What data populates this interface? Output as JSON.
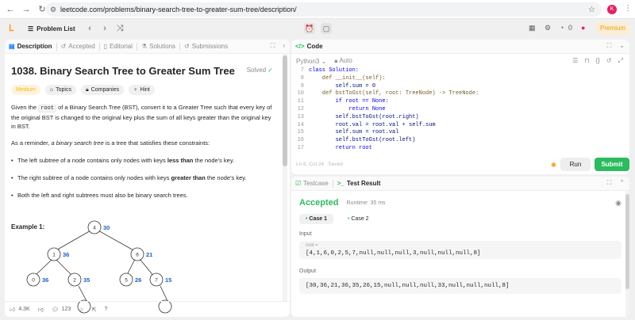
{
  "browser": {
    "url": "leetcode.com/problems/binary-search-tree-to-greater-sum-tree/description/",
    "profile_initial": "K"
  },
  "topbar": {
    "problem_list": "Problem List",
    "streak": "0",
    "premium": "Premium"
  },
  "left_tabs": [
    "Description",
    "Accepted",
    "Editorial",
    "Solutions",
    "Submissions"
  ],
  "problem": {
    "title": "1038. Binary Search Tree to Greater Sum Tree",
    "status": "Solved",
    "difficulty": "Medium",
    "tags": [
      "Topics",
      "Companies",
      "Hint"
    ],
    "p1_a": "Given the ",
    "p1_code": "root",
    "p1_b": " of a Binary Search Tree (BST), convert it to a Greater Tree such that every key of the original BST is changed to the original key plus the sum of all keys greater than the original key in BST.",
    "p2_a": "As a reminder, ",
    "p2_em": "a binary search tree",
    "p2_b": " is a tree that satisfies these constraints:",
    "b1_a": "The left subtree of a node contains only nodes with keys ",
    "b1_strong": "less than",
    "b1_b": " the node's key.",
    "b2_a": "The right subtree of a node contains only nodes with keys ",
    "b2_strong": "greater than",
    "b2_b": " the node's key.",
    "b3": "Both the left and right subtrees must also be binary search trees.",
    "example": "Example 1:"
  },
  "tree": {
    "nodes": [
      {
        "val": "4",
        "sum": "30"
      },
      {
        "val": "1",
        "sum": "36"
      },
      {
        "val": "6",
        "sum": "21"
      },
      {
        "val": "0",
        "sum": "36"
      },
      {
        "val": "2",
        "sum": "35"
      },
      {
        "val": "5",
        "sum": "26"
      },
      {
        "val": "7",
        "sum": "15"
      }
    ]
  },
  "footer": {
    "likes": "4.3K",
    "comments": "123"
  },
  "code": {
    "tab": "Code",
    "language": "Python3",
    "auto": "Auto",
    "lines": [
      {
        "n": "7",
        "t": "class Solution:"
      },
      {
        "n": "8",
        "t": "    def __init__(self):"
      },
      {
        "n": "9",
        "t": "        self.sum = 0"
      },
      {
        "n": "10",
        "t": "    def bstToGst(self, root: TreeNode) -> TreeNode:"
      },
      {
        "n": "11",
        "t": "        if root == None:"
      },
      {
        "n": "12",
        "t": "            return None"
      },
      {
        "n": "13",
        "t": "        self.bstToGst(root.right)"
      },
      {
        "n": "14",
        "t": "        root.val = root.val + self.sum"
      },
      {
        "n": "15",
        "t": "        self.sum = root.val"
      },
      {
        "n": "16",
        "t": "        self.bstToGst(root.left)"
      },
      {
        "n": "17",
        "t": "        return root"
      }
    ],
    "status": "Ln 8, Col 24   Saved",
    "run": "Run",
    "submit": "Submit"
  },
  "result": {
    "tabs": [
      "Testcase",
      "Test Result"
    ],
    "verdict": "Accepted",
    "runtime": "Runtime: 35 ms",
    "cases": [
      "Case 1",
      "Case 2"
    ],
    "input_label": "Input",
    "input_var": "root =",
    "input_value": "[4,1,6,0,2,5,7,null,null,null,3,null,null,null,8]",
    "output_label": "Output",
    "output_value": "[30,36,21,36,35,26,15,null,null,null,33,null,null,null,8]"
  }
}
